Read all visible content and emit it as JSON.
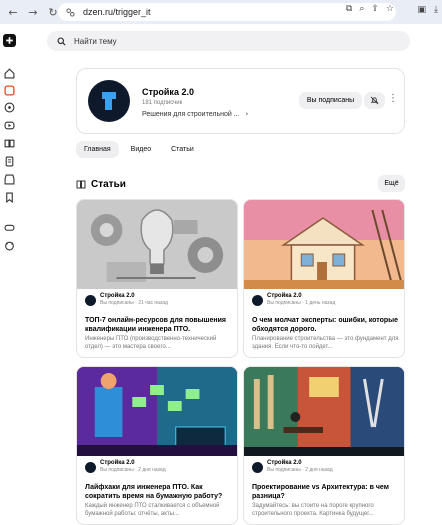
{
  "browser": {
    "url": "dzen.ru/trigger_it"
  },
  "search": {
    "placeholder": "Найти тему"
  },
  "channel": {
    "name": "Стройка 2.0",
    "subscribers": "181 подписчик",
    "description": "Решения для строительной ...",
    "subscribe_label": "Вы подписаны"
  },
  "tabs": [
    {
      "label": "Главная",
      "active": true
    },
    {
      "label": "Видео",
      "active": false
    },
    {
      "label": "Статьи",
      "active": false
    }
  ],
  "section": {
    "title": "Статьи",
    "more_label": "Ещё"
  },
  "articles": [
    {
      "author": "Стройка 2.0",
      "meta": "Вы подписаны · 21 час назад",
      "title": "ТОП-7 онлайн-ресурсов для повышения квалификации инженера ПТО.",
      "snippet": "Инженеры ПТО (производственно-технический отдел) — это мастера своего..."
    },
    {
      "author": "Стройка 2.0",
      "meta": "Вы подписаны · 1 день назад",
      "title": "О чем молчат эксперты: ошибки, которые обходятся дорого.",
      "snippet": "Планирование строительства — это фундамент для здания. Если что-то пойдет..."
    },
    {
      "author": "Стройка 2.0",
      "meta": "Вы подписаны · 2 дня назад",
      "title": "Лайфхаки для инженера ПТО. Как сократить время на бумажную работу?",
      "snippet": "Каждый инженер ПТО сталкивается с объемной бумажной работы: отчёты, акты..."
    },
    {
      "author": "Стройка 2.0",
      "meta": "Вы подписаны · 2 дня назад",
      "title": "Проектирование vs Архитектура: в чем разница?",
      "snippet": "Задумайтесь: вы стоите на пороге крупного строительного проекта. Картинка будущег..."
    }
  ]
}
